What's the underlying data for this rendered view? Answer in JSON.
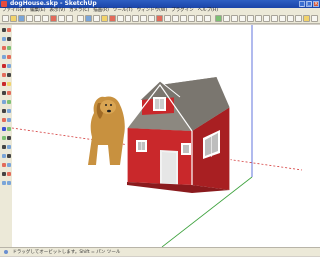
{
  "window": {
    "title": "dogHouse.skp - SketchUp"
  },
  "menu": [
    "ファイル(F)",
    "編集(E)",
    "表示(V)",
    "カメラ(C)",
    "描画(R)",
    "ツール(T)",
    "ウィンドウ(W)",
    "プラグイン",
    "ヘルプ(H)"
  ],
  "status": {
    "text": "ドラッグしてオービットします。Shift = パン ツール"
  },
  "scene": {
    "house_color": "#c9282b",
    "roof_color": "#8c8880",
    "trim_color": "#ffffff",
    "axis_red": "#d43b3b",
    "axis_green": "#3da23d",
    "axis_blue": "#3b52d4"
  }
}
